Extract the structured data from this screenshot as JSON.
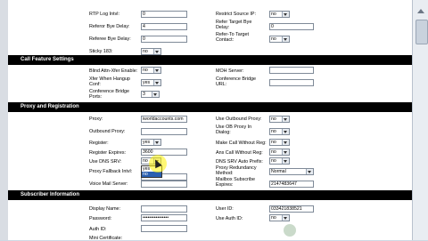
{
  "top": {
    "rtp_log_intvl": {
      "label": "RTP Log Intvl:",
      "value": "0"
    },
    "referor_bye_delay": {
      "label": "Referor Bye Delay:",
      "value": "4"
    },
    "referee_bye_delay": {
      "label": "Referee Bye Delay:",
      "value": "0"
    },
    "sticky_183": {
      "label": "Sticky 183:",
      "value": "no"
    },
    "restrict_source_ip": {
      "label": "Restrict Source IP:",
      "value": "no"
    },
    "refer_target_bye_delay": {
      "label": "Refer Target Bye Delay:",
      "value": "0"
    },
    "refer_to_target_contact": {
      "label": "Refer-To Target Contact:",
      "value": "no"
    }
  },
  "call_feature": {
    "heading": "Call Feature Settings",
    "blind_attn": {
      "label": "Blind Attn-Xfer Enable:",
      "value": "no"
    },
    "xfer_when_hangup": {
      "label": "Xfer When Hangup Conf:",
      "value": "yes"
    },
    "conf_bridge_ports": {
      "label": "Conference Bridge Ports:",
      "value": "3"
    },
    "moh_server": {
      "label": "MOH Server:",
      "value": ""
    },
    "conf_bridge_url": {
      "label": "Conference Bridge URL:",
      "value": ""
    }
  },
  "proxy": {
    "heading": "Proxy and Registration",
    "proxy": {
      "label": "Proxy:",
      "value": "iworldaccounts.com"
    },
    "outbound_proxy": {
      "label": "Outbound Proxy:",
      "value": ""
    },
    "register": {
      "label": "Register:",
      "value": "yes"
    },
    "register_expires": {
      "label": "Register Expires:",
      "value": "3600"
    },
    "use_dns_srv": {
      "label": "Use DNS SRV:",
      "value": "no",
      "options": [
        "yes",
        "no"
      ]
    },
    "proxy_fallback": {
      "label": "Proxy Fallback Intvl:",
      "value": "yes"
    },
    "voice_mail_server": {
      "label": "Voice Mail Server:",
      "value": ""
    },
    "use_outbound_proxy": {
      "label": "Use Outbound Proxy:",
      "value": "no"
    },
    "use_ob_proxy_dialog": {
      "label": "Use OB Proxy In Dialog:",
      "value": "no"
    },
    "make_call_without_reg": {
      "label": "Make Call Without Reg:",
      "value": "no"
    },
    "ans_call_without_reg": {
      "label": "Ans Call Without Reg:",
      "value": "no"
    },
    "dns_srv_auto_prefix": {
      "label": "DNS SRV Auto Prefix:",
      "value": "no"
    },
    "proxy_redundancy": {
      "label": "Proxy Redundancy Method:",
      "value": "Normal"
    },
    "mailbox_subscribe_expires": {
      "label": "Mailbox Subscribe Expires:",
      "value": "2147483647"
    }
  },
  "subscriber": {
    "heading": "Subscriber Information",
    "display_name": {
      "label": "Display Name:",
      "value": ""
    },
    "password": {
      "label": "Password:",
      "value": "••••••••••••••••"
    },
    "auth_id": {
      "label": "Auth ID:",
      "value": ""
    },
    "mini_certificate": {
      "label": "Mini Certificate:",
      "value": ""
    },
    "user_id": {
      "label": "User ID:",
      "value": "033421838521"
    },
    "use_auth_id": {
      "label": "Use Auth ID:",
      "value": "no"
    }
  },
  "colors": {
    "section_bar": "#000000",
    "highlight": "#2b5fb0",
    "cursor_halo": "#fff000"
  }
}
